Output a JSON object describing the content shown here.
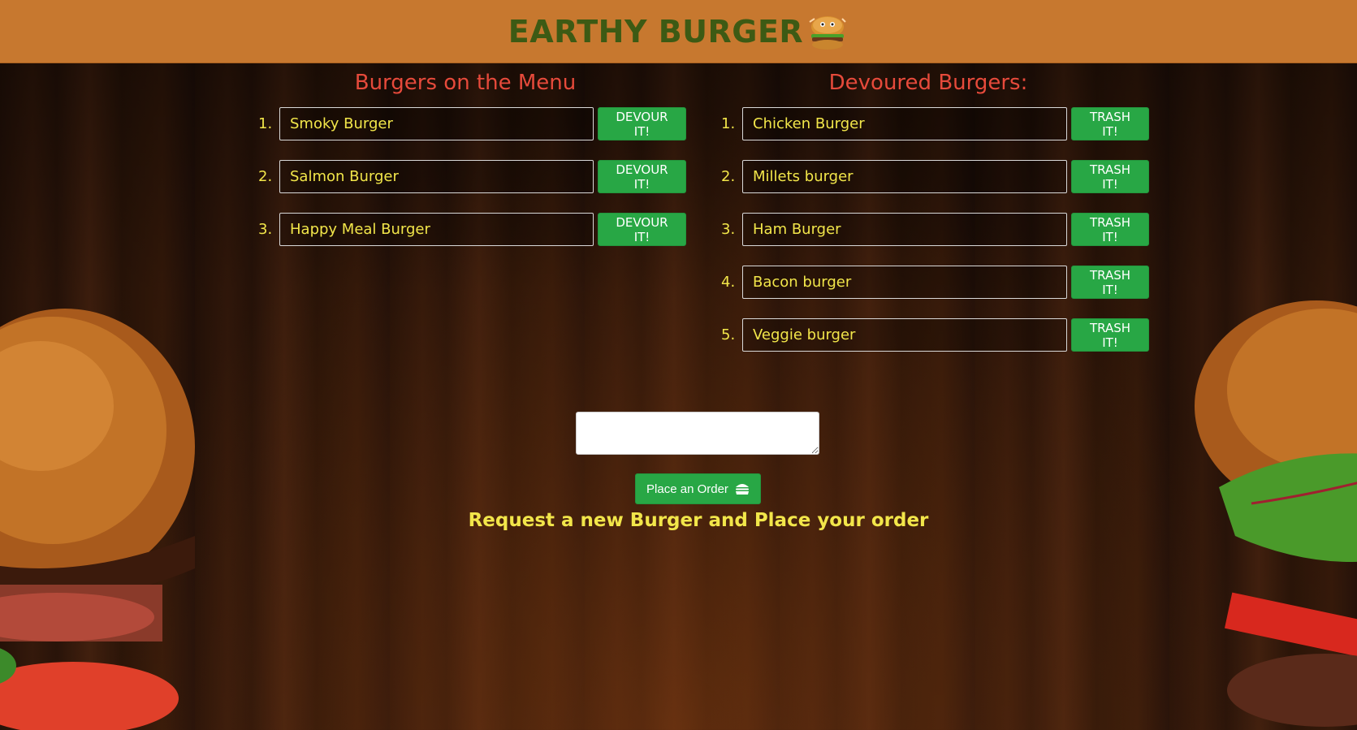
{
  "header": {
    "brand_title": "EARTHY BURGER",
    "logo_icon": "burger-mascot-icon",
    "background_color": "#c7782f",
    "title_color": "#3d5a14"
  },
  "menu": {
    "title": "Burgers on the Menu",
    "action_label": "DEVOUR IT!",
    "items": [
      {
        "number": "1.",
        "name": "Smoky Burger"
      },
      {
        "number": "2.",
        "name": "Salmon Burger"
      },
      {
        "number": "3.",
        "name": "Happy Meal Burger"
      }
    ]
  },
  "devoured": {
    "title": "Devoured Burgers:",
    "action_label": "TRASH IT!",
    "items": [
      {
        "number": "1.",
        "name": "Chicken Burger"
      },
      {
        "number": "2.",
        "name": "Millets burger"
      },
      {
        "number": "3.",
        "name": "Ham Burger"
      },
      {
        "number": "4.",
        "name": "Bacon burger"
      },
      {
        "number": "5.",
        "name": "Veggie burger"
      }
    ]
  },
  "order": {
    "input_value": "",
    "button_label": "Place an Order",
    "button_icon": "hamburger-icon",
    "hint": "Request a new Burger and Place your order"
  },
  "colors": {
    "heading": "#e64a3b",
    "text": "#f2e64a",
    "button": "#28a745"
  }
}
